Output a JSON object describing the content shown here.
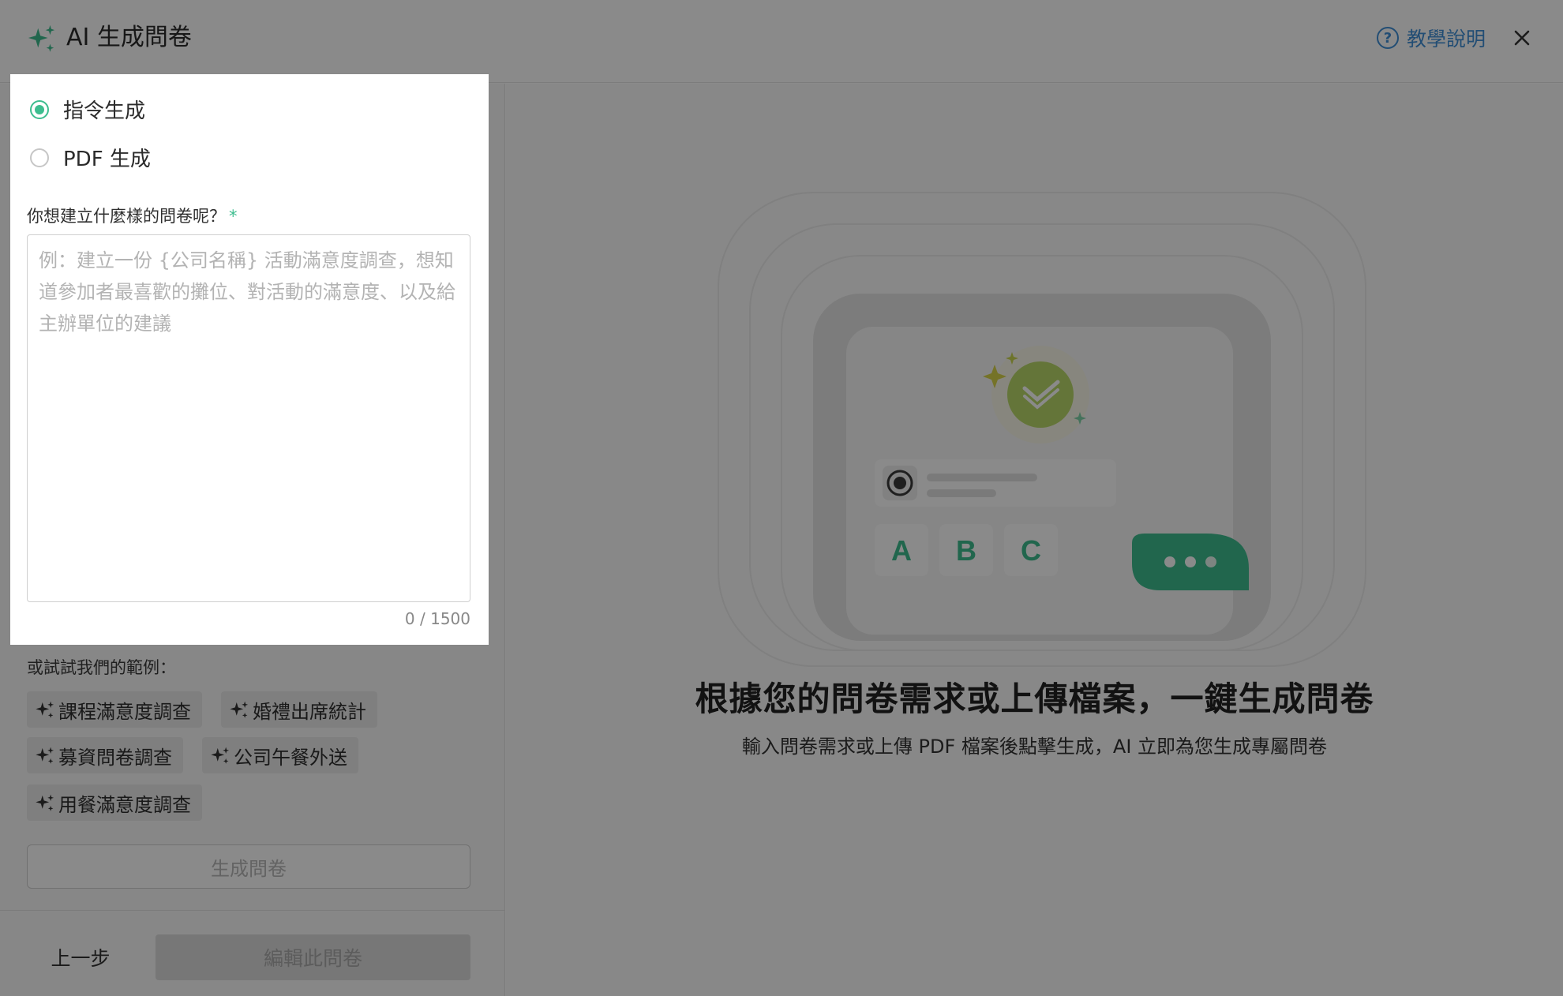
{
  "header": {
    "title": "AI 生成問卷",
    "help_label": "教學說明",
    "help_icon_glyph": "?"
  },
  "mode": {
    "options": [
      {
        "label": "指令生成",
        "selected": true
      },
      {
        "label": "PDF 生成",
        "selected": false
      }
    ]
  },
  "prompt": {
    "label": "你想建立什麼樣的問卷呢？",
    "required_mark": "*",
    "placeholder": "例：建立一份 {公司名稱} 活動滿意度調查，想知道參加者最喜歡的攤位、對活動的滿意度、以及給主辦單位的建議",
    "value": "",
    "counter": "0 / 1500"
  },
  "examples": {
    "label": "或試試我們的範例：",
    "chips": [
      "課程滿意度調查",
      "婚禮出席統計",
      "募資問卷調查",
      "公司午餐外送",
      "用餐滿意度調查"
    ]
  },
  "actions": {
    "generate_label": "生成問卷",
    "prev_label": "上一步",
    "edit_label": "編輯此問卷"
  },
  "illustration": {
    "option_letters": [
      "A",
      "B",
      "C"
    ]
  },
  "main": {
    "heading": "根據您的問卷需求或上傳檔案，一鍵生成問卷",
    "subheading": "輸入問卷需求或上傳 PDF 檔案後點擊生成，AI 立即為您生成專屬問卷"
  },
  "colors": {
    "accent_green": "#3dbd8f",
    "link_blue": "#3f8fd6",
    "overlay": "rgba(0,0,0,0.46)"
  }
}
